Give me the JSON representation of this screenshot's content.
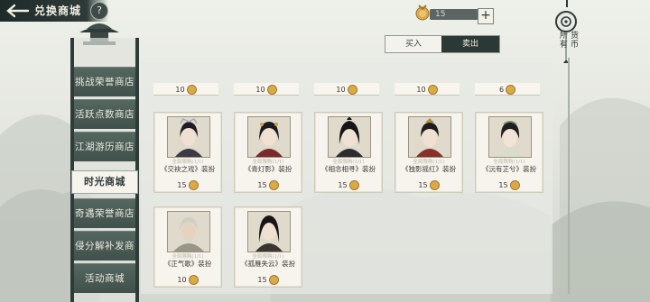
{
  "header": {
    "title": "兑换商城",
    "help_label": "?"
  },
  "currency": {
    "value": "15",
    "add_label": "+",
    "icon": "medal-coin-icon"
  },
  "ornament": {
    "label": "所有货币",
    "chars": [
      "所",
      "有",
      "货",
      "币"
    ]
  },
  "tabs": {
    "buy_label": "买入",
    "sell_label": "卖出",
    "active": "sell"
  },
  "sidebar": {
    "items": [
      {
        "label": "挑战荣誉商店",
        "active": false
      },
      {
        "label": "活跃点数商店",
        "active": false
      },
      {
        "label": "江湖游历商店",
        "active": false
      },
      {
        "label": "时光商城",
        "active": true
      },
      {
        "label": "奇遇荣誉商店",
        "active": false
      },
      {
        "label": "侵分解补发商",
        "active": false
      },
      {
        "label": "活动商城",
        "active": false
      }
    ]
  },
  "top_strip": {
    "prices": [
      "10",
      "10",
      "10",
      "10",
      "6"
    ]
  },
  "cards": [
    {
      "limit": "全局限购(1/1)",
      "name": "《交袂之戏》装扮",
      "price": "15"
    },
    {
      "limit": "全局限购(1/1)",
      "name": "《青灯影》装扮",
      "price": "15"
    },
    {
      "limit": "全局限购(1/1)",
      "name": "《相念相寻》装扮",
      "price": "15"
    },
    {
      "limit": "全局限购(1/1)",
      "name": "《独影摇红》装扮",
      "price": "15"
    },
    {
      "limit": "全局限购(1/1)",
      "name": "《沅有芷兮》装扮",
      "price": "15"
    },
    {
      "limit": "全局限购(1/1)",
      "name": "《正气歌》装扮",
      "price": "10"
    },
    {
      "limit": "全局限购(1/1)",
      "name": "《孤雁失云》装扮",
      "price": "15"
    }
  ],
  "colors": {
    "dark_green": "#2e3b39",
    "sidebar_green": "#4b5c56",
    "coin_gold": "#d9a94a",
    "panel": "#e8eae4"
  }
}
